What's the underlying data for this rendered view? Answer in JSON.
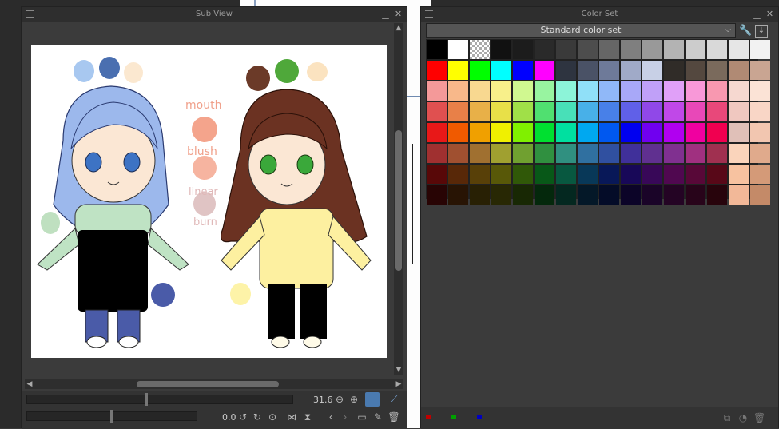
{
  "subview": {
    "title": "Sub View",
    "zoom_value": "31.6",
    "rotation_value": "0.0",
    "image_labels": {
      "mouth": "mouth",
      "blush": "blush",
      "linear": "linear",
      "burn": "burn"
    }
  },
  "colorset": {
    "title": "Color Set",
    "set_name": "Standard color set",
    "rows": [
      [
        "#000000",
        "#ffffff",
        "checker",
        "#111111",
        "#1c1c1c",
        "#2a2a2a",
        "#3a3a3a",
        "#4d4d4d",
        "#666666",
        "#7f7f7f",
        "#999999",
        "#b3b3b3",
        "#cccccc",
        "#d9d9d9",
        "#e6e6e6",
        "#f2f2f2"
      ],
      [
        "#ff0000",
        "#ffff00",
        "#00ff00",
        "#00ffff",
        "#0000ff",
        "#ff00ff",
        "#2e3440",
        "#4a5266",
        "#6e7a99",
        "#a0aac8",
        "#c8d0e6",
        "#302c28",
        "#54483f",
        "#7a6a5c",
        "#b08a74",
        "#c9a592"
      ],
      [
        "#f49999",
        "#f8b88a",
        "#f8d890",
        "#f8f08a",
        "#d0f890",
        "#98f4a0",
        "#8cf4d8",
        "#90e0f8",
        "#90b8f8",
        "#a8a8f8",
        "#c0a0f8",
        "#e0a0f8",
        "#f898d8",
        "#f898b0",
        "#f6d8d0",
        "#fbe3d6"
      ],
      [
        "#e05050",
        "#e88048",
        "#e8b048",
        "#e8e048",
        "#a0e048",
        "#50e070",
        "#48e0b8",
        "#48b0e8",
        "#4880e8",
        "#6060e8",
        "#9048e8",
        "#c048e8",
        "#e848b8",
        "#e8487a",
        "#f0c8c0",
        "#f9d6c6"
      ],
      [
        "#e81818",
        "#f05a00",
        "#f0a000",
        "#f0f000",
        "#80f000",
        "#00e030",
        "#00e0a0",
        "#00a8f0",
        "#0058f0",
        "#0000f0",
        "#7000f0",
        "#b000f0",
        "#f000a0",
        "#f00050",
        "#e0c0b8",
        "#f2c6b0"
      ],
      [
        "#a03030",
        "#a05030",
        "#a07030",
        "#a0a030",
        "#70a030",
        "#309040",
        "#309080",
        "#3070a0",
        "#3050a0",
        "#40309a",
        "#603090",
        "#803090",
        "#a03080",
        "#a03050",
        "#fad4bb",
        "#e0aa8c"
      ],
      [
        "#580808",
        "#582808",
        "#584008",
        "#585808",
        "#305808",
        "#085818",
        "#085840",
        "#083858",
        "#081858",
        "#180858",
        "#380858",
        "#500850",
        "#580838",
        "#580818",
        "#f7c2a0",
        "#d49a78"
      ],
      [
        "#280404",
        "#281404",
        "#282004",
        "#282804",
        "#182804",
        "#04280c",
        "#042820",
        "#041828",
        "#040c28",
        "#0c0428",
        "#1a0428",
        "#240424",
        "#28041a",
        "#28040c",
        "#f2b898",
        "#c48a68"
      ]
    ]
  }
}
